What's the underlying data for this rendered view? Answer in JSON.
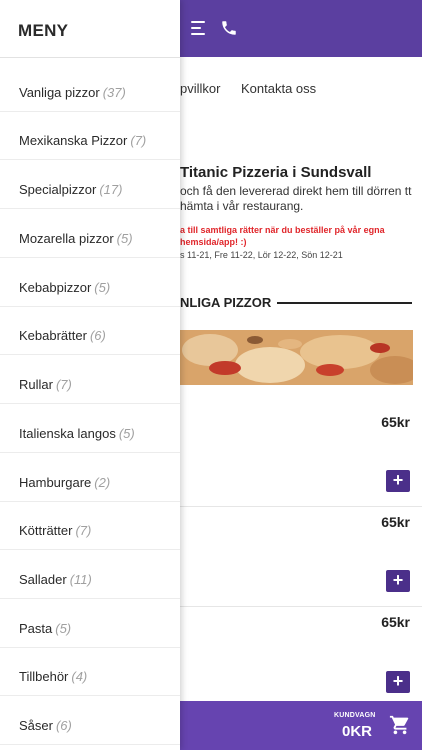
{
  "drawer": {
    "title": "MENY",
    "items": [
      {
        "label": "Vanliga pizzor",
        "count": "(37)"
      },
      {
        "label": "Mexikanska Pizzor",
        "count": "(7)"
      },
      {
        "label": "Specialpizzor",
        "count": "(17)"
      },
      {
        "label": "Mozarella pizzor",
        "count": "(5)"
      },
      {
        "label": "Kebabpizzor",
        "count": "(5)"
      },
      {
        "label": "Kebabrätter",
        "count": "(6)"
      },
      {
        "label": "Rullar",
        "count": "(7)"
      },
      {
        "label": "Italienska langos",
        "count": "(5)"
      },
      {
        "label": "Hamburgare",
        "count": "(2)"
      },
      {
        "label": "Kötträtter",
        "count": "(7)"
      },
      {
        "label": "Sallader",
        "count": "(11)"
      },
      {
        "label": "Pasta",
        "count": "(5)"
      },
      {
        "label": "Tillbehör",
        "count": "(4)"
      },
      {
        "label": "Såser",
        "count": "(6)"
      }
    ]
  },
  "header": {
    "menu_icon": "hamburger-icon",
    "phone_icon": "phone-icon"
  },
  "nav": {
    "terms": "pvillkor",
    "contact": "Kontakta oss"
  },
  "restaurant": {
    "title": "Titanic Pizzeria i Sundsvall",
    "description": "och få den levererad direkt hem till dörren tt hämta i vår restaurang.",
    "promo": "a till samtliga rätter när du beställer på vår egna hemsida/app! :)",
    "hours": "s 11-21, Fre 11-22, Lör 12-22, Sön 12-21"
  },
  "category": {
    "heading": "NLIGA PIZZOR"
  },
  "products": [
    {
      "price": "65kr",
      "add": "+"
    },
    {
      "price": "65kr",
      "add": "+"
    },
    {
      "price": "65kr",
      "add": "+"
    }
  ],
  "cart": {
    "label": "KUNDVAGN",
    "total": "0KR",
    "icon": "cart-icon"
  },
  "colors": {
    "header_purple": "#5b3fa0",
    "button_purple": "#4b2f8a",
    "promo_red": "#e0262b"
  }
}
